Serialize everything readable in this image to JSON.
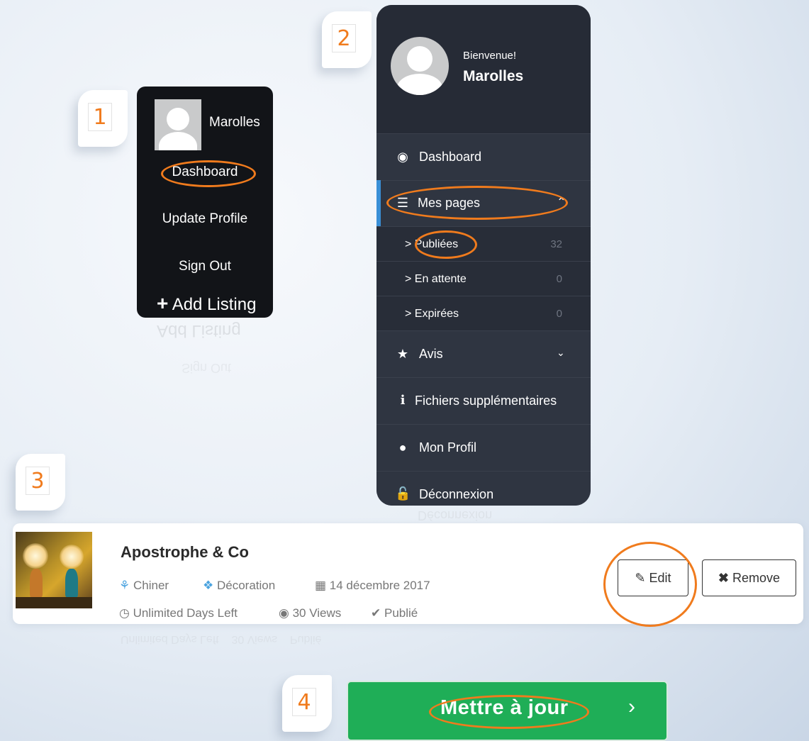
{
  "steps": [
    "1",
    "2",
    "3",
    "4"
  ],
  "panel1": {
    "username": "Marolles",
    "dashboard": "Dashboard",
    "update_profile": "Update Profile",
    "sign_out": "Sign Out",
    "add_plus": "+",
    "add_listing": "Add Listing"
  },
  "panel2": {
    "welcome": "Bienvenue!",
    "username": "Marolles",
    "dashboard": "Dashboard",
    "mes_pages": "Mes pages",
    "sub_items": [
      {
        "label": "> Publiées",
        "count": "32"
      },
      {
        "label": "> En attente",
        "count": "0"
      },
      {
        "label": "> Expirées",
        "count": "0"
      }
    ],
    "avis": "Avis",
    "fichiers": "Fichiers supplémentaires",
    "mon_profil": "Mon Profil",
    "deconnexion": "Déconnexion"
  },
  "listing": {
    "title": "Apostrophe & Co",
    "category": "Chiner",
    "subcategory": "Décoration",
    "date": "14 décembre 2017",
    "days_left": "Unlimited Days Left",
    "views": "30 Views",
    "status": "Publié",
    "edit": "Edit",
    "remove": "Remove"
  },
  "update_button": "Mettre à jour",
  "colors": {
    "accent_orange": "#f07b1d",
    "sidebar_bg": "#272c37",
    "green": "#1fae57",
    "active_bar": "#3a8fd6"
  }
}
